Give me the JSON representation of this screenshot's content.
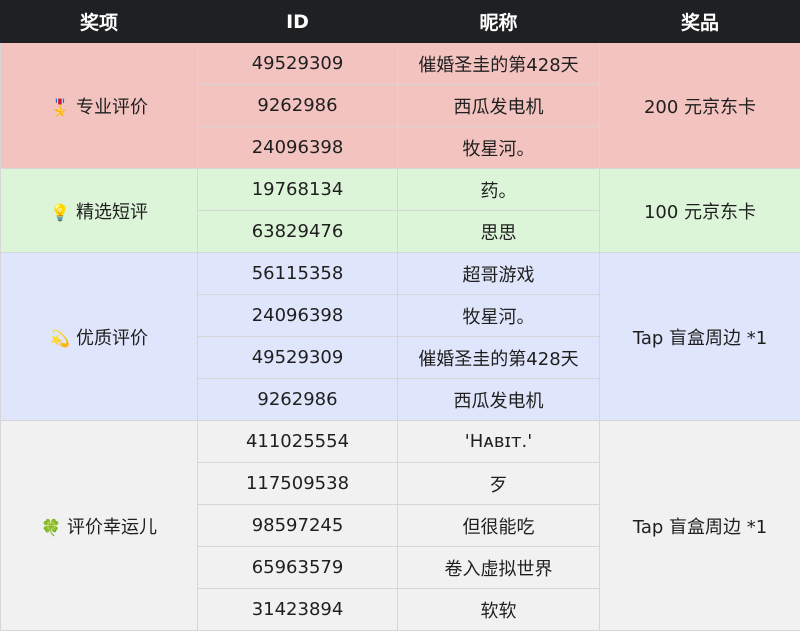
{
  "headers": {
    "category": "奖项",
    "id": "ID",
    "nickname": "昵称",
    "prize": "奖品"
  },
  "colors": {
    "header_bg": "#1f2022",
    "pro": "#f3c3c0",
    "pick": "#dcf5d8",
    "quality": "#dfe5fb",
    "lucky": "#f1f1f1"
  },
  "groups": [
    {
      "emoji": "🎖️",
      "icon": "medal-icon",
      "category": "专业评价",
      "prize": "200 元京东卡",
      "color": "#f3c3c0",
      "rows": [
        {
          "id": "49529309",
          "nickname": "催婚圣圭的第428天"
        },
        {
          "id": "9262986",
          "nickname": "西瓜发电机"
        },
        {
          "id": "24096398",
          "nickname": "牧星河。"
        }
      ]
    },
    {
      "emoji": "💡",
      "icon": "light-bulb-icon",
      "category": "精选短评",
      "prize": "100 元京东卡",
      "color": "#dcf5d8",
      "rows": [
        {
          "id": "19768134",
          "nickname": "药。"
        },
        {
          "id": "63829476",
          "nickname": "思思"
        }
      ]
    },
    {
      "emoji": "💫",
      "icon": "dizzy-star-icon",
      "category": "优质评价",
      "prize": "Tap 盲盒周边 *1",
      "color": "#dfe5fb",
      "rows": [
        {
          "id": "56115358",
          "nickname": "超哥游戏"
        },
        {
          "id": "24096398",
          "nickname": "牧星河。"
        },
        {
          "id": "49529309",
          "nickname": "催婚圣圭的第428天"
        },
        {
          "id": "9262986",
          "nickname": "西瓜发电机"
        }
      ]
    },
    {
      "emoji": "🍀",
      "icon": "four-leaf-clover-icon",
      "category": "评价幸运儿",
      "prize": "Tap 盲盒周边 *1",
      "color": "#f1f1f1",
      "rows": [
        {
          "id": "411025554",
          "nickname": "'Hᴀʙɪᴛ.'"
        },
        {
          "id": "117509538",
          "nickname": "歹"
        },
        {
          "id": "98597245",
          "nickname": "但很能吃"
        },
        {
          "id": "65963579",
          "nickname": "卷入虚拟世界"
        },
        {
          "id": "31423894",
          "nickname": "软软"
        }
      ]
    }
  ]
}
